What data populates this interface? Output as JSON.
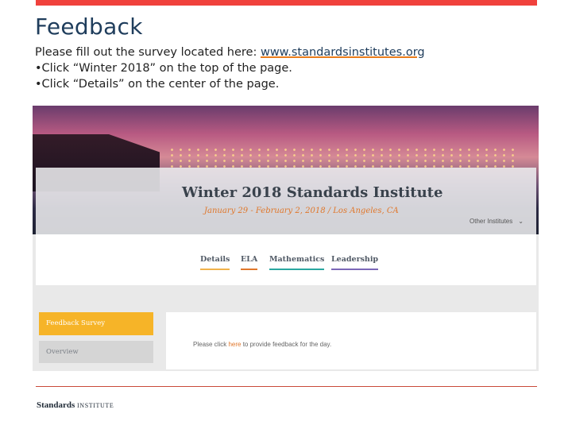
{
  "slide": {
    "title": "Feedback",
    "intro": "Please fill out the survey located here: ",
    "url": "www.standardsinstitutes.org",
    "step1": "•Click “Winter 2018” on the top of the page.",
    "step2": "•Click “Details” on the center of the page."
  },
  "site": {
    "event_title": "Winter 2018 Standards Institute",
    "event_subtitle": "January 29 - February 2, 2018 / Los Angeles, CA",
    "other_institutes": "Other Institutes",
    "tabs": [
      "Details",
      "ELA",
      "Mathematics",
      "Leadership"
    ],
    "sidebar": [
      "Feedback Survey",
      "Overview"
    ],
    "content_before": "Please click ",
    "content_link": "here",
    "content_after": " to provide feedback for the day."
  },
  "logo": {
    "word1": "Standards",
    "word2": "INSTITUTE"
  },
  "colors": {
    "accent_red": "#f0413c",
    "survey_orange": "#f6b428",
    "text_orange": "#e0772b"
  }
}
